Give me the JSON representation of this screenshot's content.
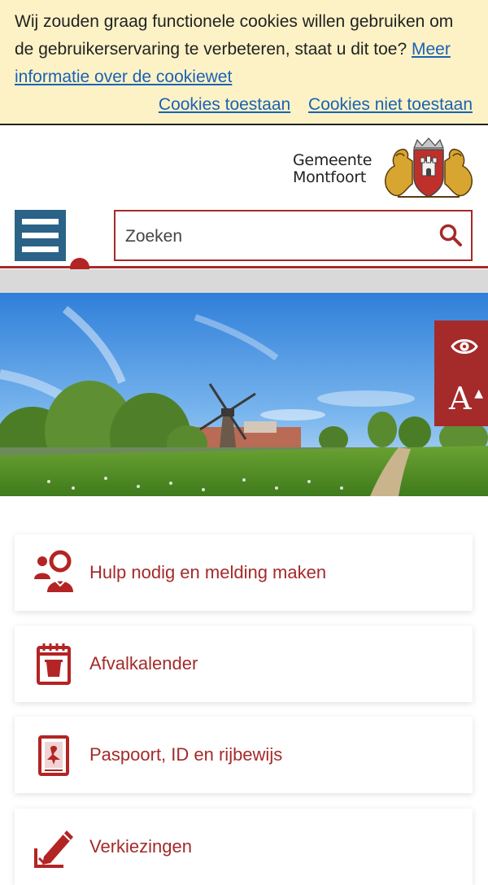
{
  "cookie_banner": {
    "message": "Wij zouden graag functionele cookies willen gebruiken om de gebruikerservaring te verbeteren, staat u dit toe?",
    "more_info_link": "Meer informatie over de cookiewet",
    "allow_label": "Cookies toestaan",
    "deny_label": "Cookies niet toestaan"
  },
  "header": {
    "logo_line1": "Gemeente",
    "logo_line2": "Montfoort"
  },
  "search": {
    "placeholder": "Zoeken"
  },
  "tiles": [
    {
      "label": "Hulp nodig en melding maken",
      "icon": "people-help-icon"
    },
    {
      "label": "Afvalkalender",
      "icon": "waste-calendar-icon"
    },
    {
      "label": "Paspoort, ID en rijbewijs",
      "icon": "passport-icon"
    },
    {
      "label": "Verkiezingen",
      "icon": "pencil-ballot-icon"
    }
  ],
  "colors": {
    "brand_red": "#a52a2a",
    "menu_blue": "#2a6387",
    "cookie_bg": "#fcf2c6",
    "link_blue": "#1a62b5"
  }
}
